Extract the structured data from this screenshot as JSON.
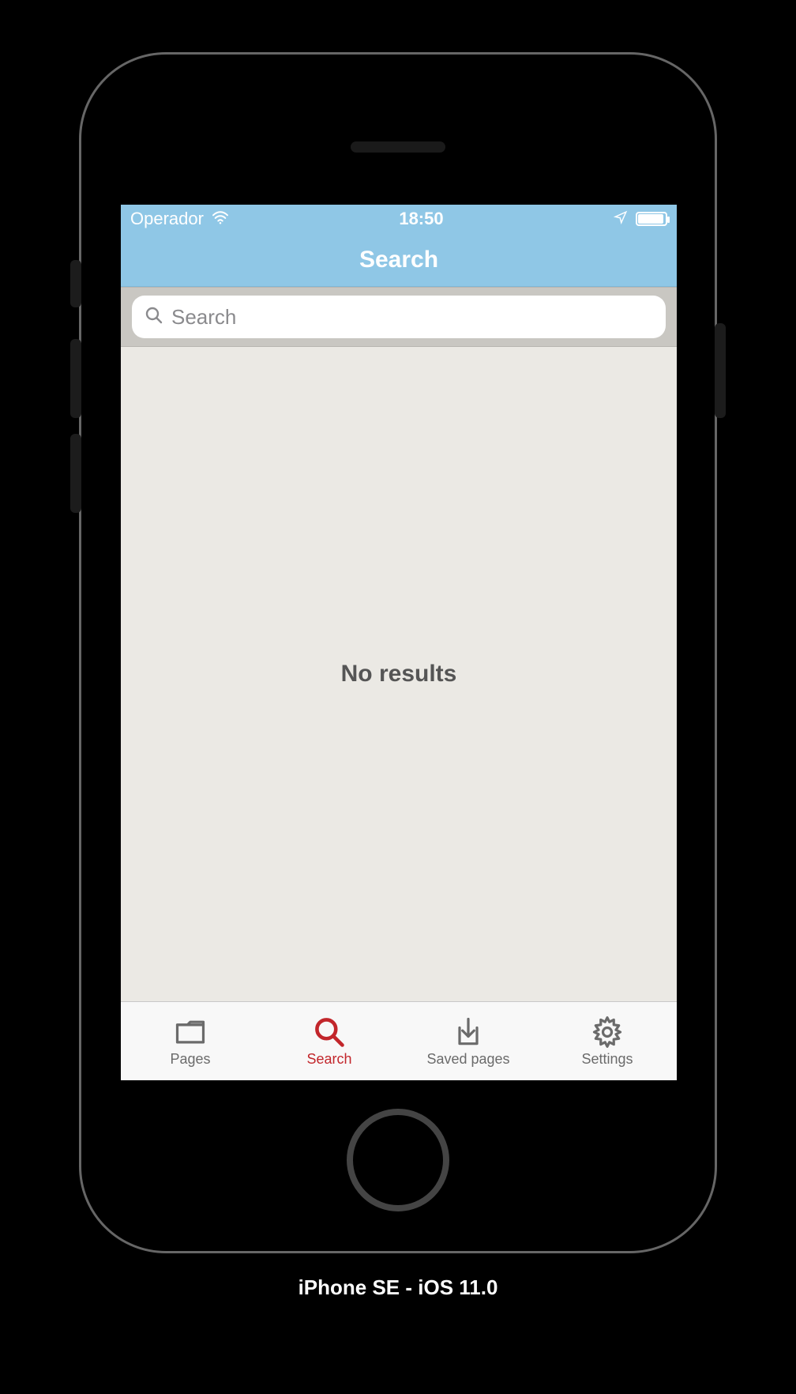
{
  "status_bar": {
    "carrier": "Operador",
    "time": "18:50"
  },
  "nav": {
    "title": "Search"
  },
  "search": {
    "placeholder": "Search",
    "value": ""
  },
  "content": {
    "empty_label": "No results"
  },
  "tab_bar": {
    "items": [
      {
        "label": "Pages",
        "icon": "folder",
        "active": false
      },
      {
        "label": "Search",
        "icon": "search",
        "active": true
      },
      {
        "label": "Saved pages",
        "icon": "download",
        "active": false
      },
      {
        "label": "Settings",
        "icon": "gear",
        "active": false
      }
    ]
  },
  "caption": "iPhone SE - iOS 11.0",
  "colors": {
    "header": "#8fc7e6",
    "accent": "#c2262b",
    "content_bg": "#ebe9e4",
    "inactive": "#6b6b6b"
  }
}
